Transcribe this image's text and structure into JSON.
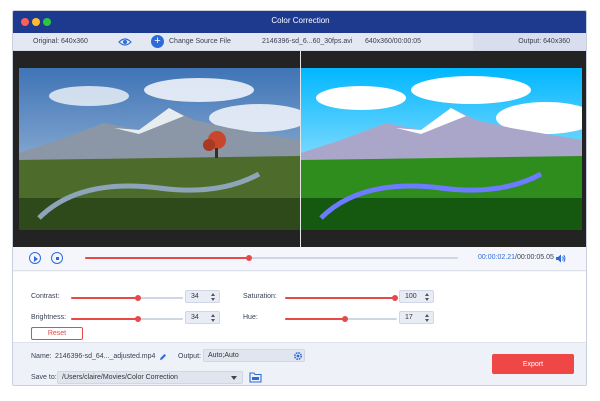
{
  "window": {
    "title": "Color Correction"
  },
  "info_bar": {
    "original_label": "Original: 640x360",
    "change_source_label": "Change Source File",
    "file_name": "2146396-sd_6...60_30fps.avi",
    "file_resolution": "640x360/00:00:05",
    "output_label": "Output: 640x360"
  },
  "playback": {
    "current_time": "00:00:02.21",
    "separator": "/",
    "total_time": "00:00:05.05",
    "progress_fraction": 0.44
  },
  "adjustments": {
    "contrast": {
      "label": "Contrast:",
      "value": "34",
      "slider_fraction": 0.6
    },
    "saturation": {
      "label": "Saturation:",
      "value": "100",
      "slider_fraction": 0.98
    },
    "brightness": {
      "label": "Brightness:",
      "value": "34",
      "slider_fraction": 0.6
    },
    "hue": {
      "label": "Hue:",
      "value": "17",
      "slider_fraction": 0.54
    },
    "reset_label": "Reset"
  },
  "footer": {
    "name_label": "Name:",
    "name_value": "2146396-sd_64..._adjusted.mp4",
    "output_label": "Output:",
    "output_value": "Auto;Auto",
    "save_to_label": "Save to:",
    "save_to_value": "/Users/claire/Movies/Color Correction",
    "export_label": "Export"
  },
  "colors": {
    "title_bar": "#1d3a8f",
    "accent_blue": "#2f6bd8",
    "accent_red": "#e74848"
  }
}
